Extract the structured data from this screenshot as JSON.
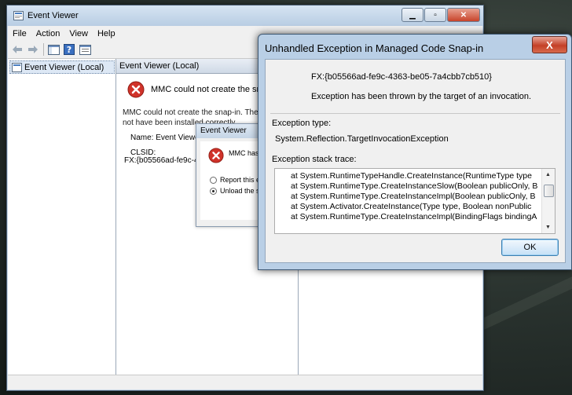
{
  "colors": {
    "error_red": "#d0332a",
    "title_bar": "#b8cde3",
    "dialog_bg": "#f0f0f0"
  },
  "event_viewer": {
    "title": "Event Viewer",
    "menu": [
      "File",
      "Action",
      "View",
      "Help"
    ],
    "toolbar_icons": [
      "back-arrow-icon",
      "forward-arrow-icon",
      "console-tree-icon",
      "help-icon",
      "properties-icon"
    ],
    "tree_item": "Event Viewer (Local)",
    "panel_header": "Event Viewer (Local)",
    "snapin_error_title": "MMC could not create the snap-in.",
    "snapin_error_desc": "MMC could not create the snap-in. The snap-in\nnot have been installed correctly.",
    "name_label": "Name: Event Viewer",
    "clsid_label": "CLSID:",
    "clsid_value": "FX:{b05566ad-fe9c-4363-"
  },
  "small_dialog": {
    "title": "Event Viewer",
    "message": "MMC has",
    "option_report": "Report this erro",
    "option_unload": "Unload the snap"
  },
  "exception_dialog": {
    "title": "Unhandled Exception in Managed Code Snap-in",
    "close_label": "X",
    "fx_id": "FX:{b05566ad-fe9c-4363-be05-7a4cbb7cb510}",
    "message": "Exception has been thrown by the target of an invocation.",
    "type_label": "Exception type:",
    "type_value": "System.Reflection.TargetInvocationException",
    "trace_label": "Exception stack trace:",
    "trace_lines": [
      "at System.RuntimeTypeHandle.CreateInstance(RuntimeType type",
      "at System.RuntimeType.CreateInstanceSlow(Boolean publicOnly, B",
      "at System.RuntimeType.CreateInstanceImpl(Boolean publicOnly, B",
      "at System.Activator.CreateInstance(Type type, Boolean nonPublic",
      "at System.RuntimeType.CreateInstanceImpl(BindingFlags bindingA"
    ],
    "ok_label": "OK"
  }
}
